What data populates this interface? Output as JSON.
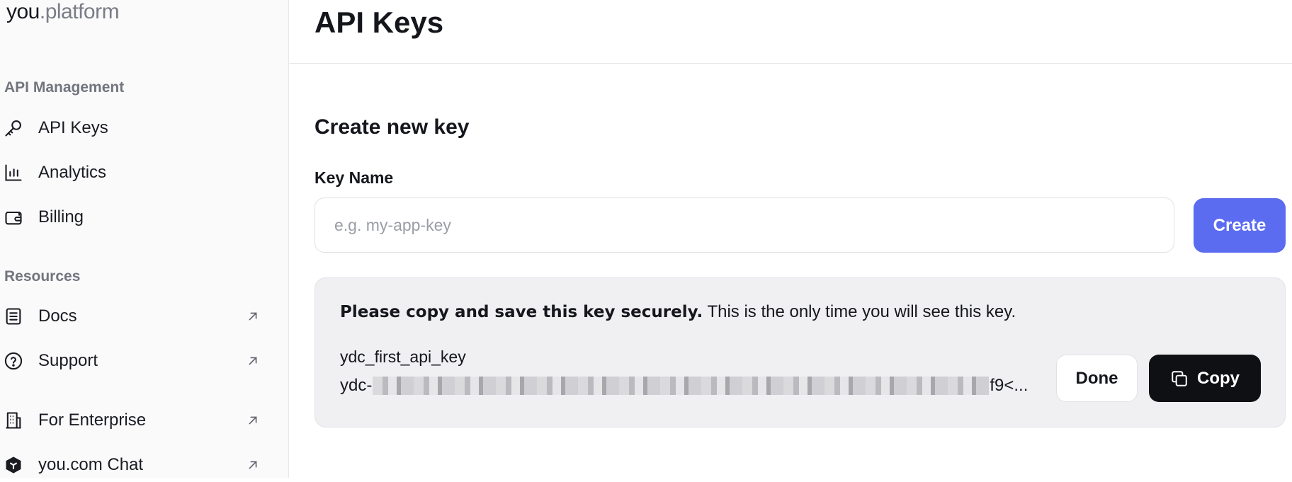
{
  "logo": {
    "you": "you",
    "platform": ".platform"
  },
  "sidebar": {
    "api_management_label": "API Management",
    "resources_label": "Resources",
    "items": [
      {
        "label": "API Keys",
        "icon": "key-icon"
      },
      {
        "label": "Analytics",
        "icon": "bar-chart-icon"
      },
      {
        "label": "Billing",
        "icon": "wallet-icon"
      },
      {
        "label": "Docs",
        "icon": "document-icon",
        "external": true
      },
      {
        "label": "Support",
        "icon": "help-circle-icon",
        "external": true
      },
      {
        "label": "For Enterprise",
        "icon": "building-icon",
        "external": true
      },
      {
        "label": "you.com Chat",
        "icon": "you-logo-icon",
        "external": true
      }
    ]
  },
  "main": {
    "title": "API Keys",
    "create_section_title": "Create new key",
    "key_name_label": "Key Name",
    "key_name_placeholder": "e.g. my-app-key",
    "create_button": "Create",
    "notice": {
      "bold": "Please copy and save this key securely.",
      "text": " This is the only time you will see this key.",
      "key_name": "ydc_first_api_key",
      "key_prefix": "ydc-",
      "key_suffix": "f9<...",
      "done_button": "Done",
      "copy_button": "Copy"
    }
  },
  "colors": {
    "accent": "#5b6cf0",
    "copy_button_bg": "#0f1013",
    "notice_bg": "#f0f0f2"
  }
}
